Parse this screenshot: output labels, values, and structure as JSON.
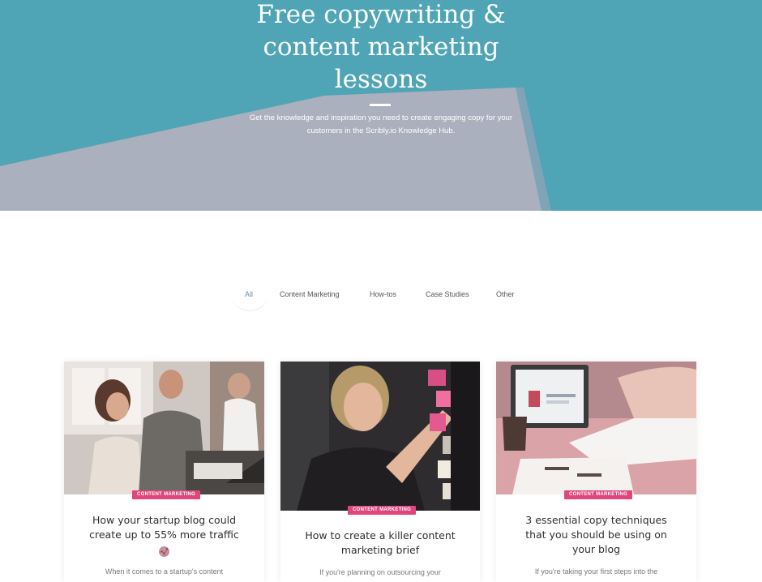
{
  "hero": {
    "title_line1": "Free copywriting &",
    "title_line2": "content marketing",
    "title_line3": "lessons",
    "subtitle_line1": "Get the knowledge and inspiration you need to create engaging copy for your",
    "subtitle_line2": "customers in the Scribly.io Knowledge Hub.",
    "background_color": "#4fa5b6",
    "shape_color": "#abb0bf"
  },
  "filters": {
    "tabs": [
      {
        "label": "All",
        "active": true
      },
      {
        "label": "Content Marketing",
        "active": false
      },
      {
        "label": "How-tos",
        "active": false
      },
      {
        "label": "Case Studies",
        "active": false
      },
      {
        "label": "Other",
        "active": false
      }
    ]
  },
  "cards": [
    {
      "category": "CONTENT MARKETING",
      "title_line1": "How your startup blog could",
      "title_line2": "create up to 55% more traffic",
      "emoji": "rocket-emoji-icon",
      "excerpt": "When it comes to a startup's content"
    },
    {
      "category": "CONTENT MARKETING",
      "title_line1": "How to create a killer content",
      "title_line2": "marketing brief",
      "excerpt": "If you're planning on outsourcing your"
    },
    {
      "category": "CONTENT MARKETING",
      "title_line1": "3 essential copy techniques",
      "title_line2": "that you should be using on",
      "title_line3": "your blog",
      "excerpt": "If you're taking your first steps into the"
    }
  ],
  "colors": {
    "accent_pink": "#e0457b",
    "active_tab": "#6b8ab4"
  }
}
